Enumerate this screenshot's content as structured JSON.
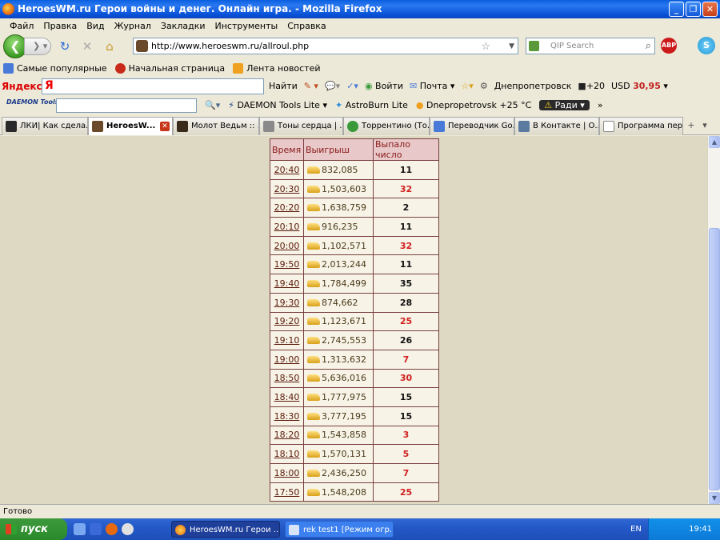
{
  "window": {
    "title": "HeroesWM.ru Герои войны и денег. Онлайн игра. - Mozilla Firefox"
  },
  "menu": [
    "Файл",
    "Правка",
    "Вид",
    "Журнал",
    "Закладки",
    "Инструменты",
    "Справка"
  ],
  "nav": {
    "url": "http://www.heroeswm.ru/allroul.php",
    "search_placeholder": "QIP Search",
    "abp": "ABP"
  },
  "bookmarks": [
    "Самые популярные",
    "Начальная страница",
    "Лента новостей"
  ],
  "yandex": {
    "logo": "Яндекс",
    "search_btn": "Найти",
    "login": "Войти",
    "mail": "Почта",
    "city": "Днепропетровск",
    "temp": "+20",
    "currency": "USD",
    "rate": "30,95"
  },
  "daemon": {
    "logo": "DAEMON Tools",
    "lite": "DAEMON Tools Lite",
    "astro": "AstroBurn Lite",
    "weather": "Dnepropetrovsk +25 °C",
    "radio": "Ради"
  },
  "tabs": [
    {
      "label": "ЛКИ| Как сдела...",
      "color": "#2a2a2a"
    },
    {
      "label": "HeroesW...",
      "color": "#6a4a2a",
      "active": true
    },
    {
      "label": "Молот Ведьм :: ...",
      "color": "#3a2a1a"
    },
    {
      "label": "Тоны сердца | ...",
      "color": "#8a8a8a"
    },
    {
      "label": "Торрентино (То...",
      "color": "#3a9a3a"
    },
    {
      "label": "Переводчик Go...",
      "color": "#4a7ad8"
    },
    {
      "label": "В Контакте | О...",
      "color": "#5a7aa0"
    },
    {
      "label": "Программа пер...",
      "color": "#e8e8e8"
    }
  ],
  "table": {
    "headers": [
      "Время",
      "Выигрыш",
      "Выпало число"
    ],
    "rows": [
      {
        "time": "20:40",
        "win": "832,085",
        "num": "11",
        "red": false
      },
      {
        "time": "20:30",
        "win": "1,503,603",
        "num": "32",
        "red": true
      },
      {
        "time": "20:20",
        "win": "1,638,759",
        "num": "2",
        "red": false
      },
      {
        "time": "20:10",
        "win": "916,235",
        "num": "11",
        "red": false
      },
      {
        "time": "20:00",
        "win": "1,102,571",
        "num": "32",
        "red": true
      },
      {
        "time": "19:50",
        "win": "2,013,244",
        "num": "11",
        "red": false
      },
      {
        "time": "19:40",
        "win": "1,784,499",
        "num": "35",
        "red": false
      },
      {
        "time": "19:30",
        "win": "874,662",
        "num": "28",
        "red": false
      },
      {
        "time": "19:20",
        "win": "1,123,671",
        "num": "25",
        "red": true
      },
      {
        "time": "19:10",
        "win": "2,745,553",
        "num": "26",
        "red": false
      },
      {
        "time": "19:00",
        "win": "1,313,632",
        "num": "7",
        "red": true
      },
      {
        "time": "18:50",
        "win": "5,636,016",
        "num": "30",
        "red": true
      },
      {
        "time": "18:40",
        "win": "1,777,975",
        "num": "15",
        "red": false
      },
      {
        "time": "18:30",
        "win": "3,777,195",
        "num": "15",
        "red": false
      },
      {
        "time": "18:20",
        "win": "1,543,858",
        "num": "3",
        "red": true
      },
      {
        "time": "18:10",
        "win": "1,570,131",
        "num": "5",
        "red": true
      },
      {
        "time": "18:00",
        "win": "2,436,250",
        "num": "7",
        "red": true
      },
      {
        "time": "17:50",
        "win": "1,548,208",
        "num": "25",
        "red": true
      }
    ]
  },
  "status": "Готово",
  "taskbar": {
    "start": "пуск",
    "task1": "HeroesWM.ru Герои ...",
    "task2": "rek test1 [Режим огр...",
    "lang": "EN",
    "clock": "19:41"
  }
}
